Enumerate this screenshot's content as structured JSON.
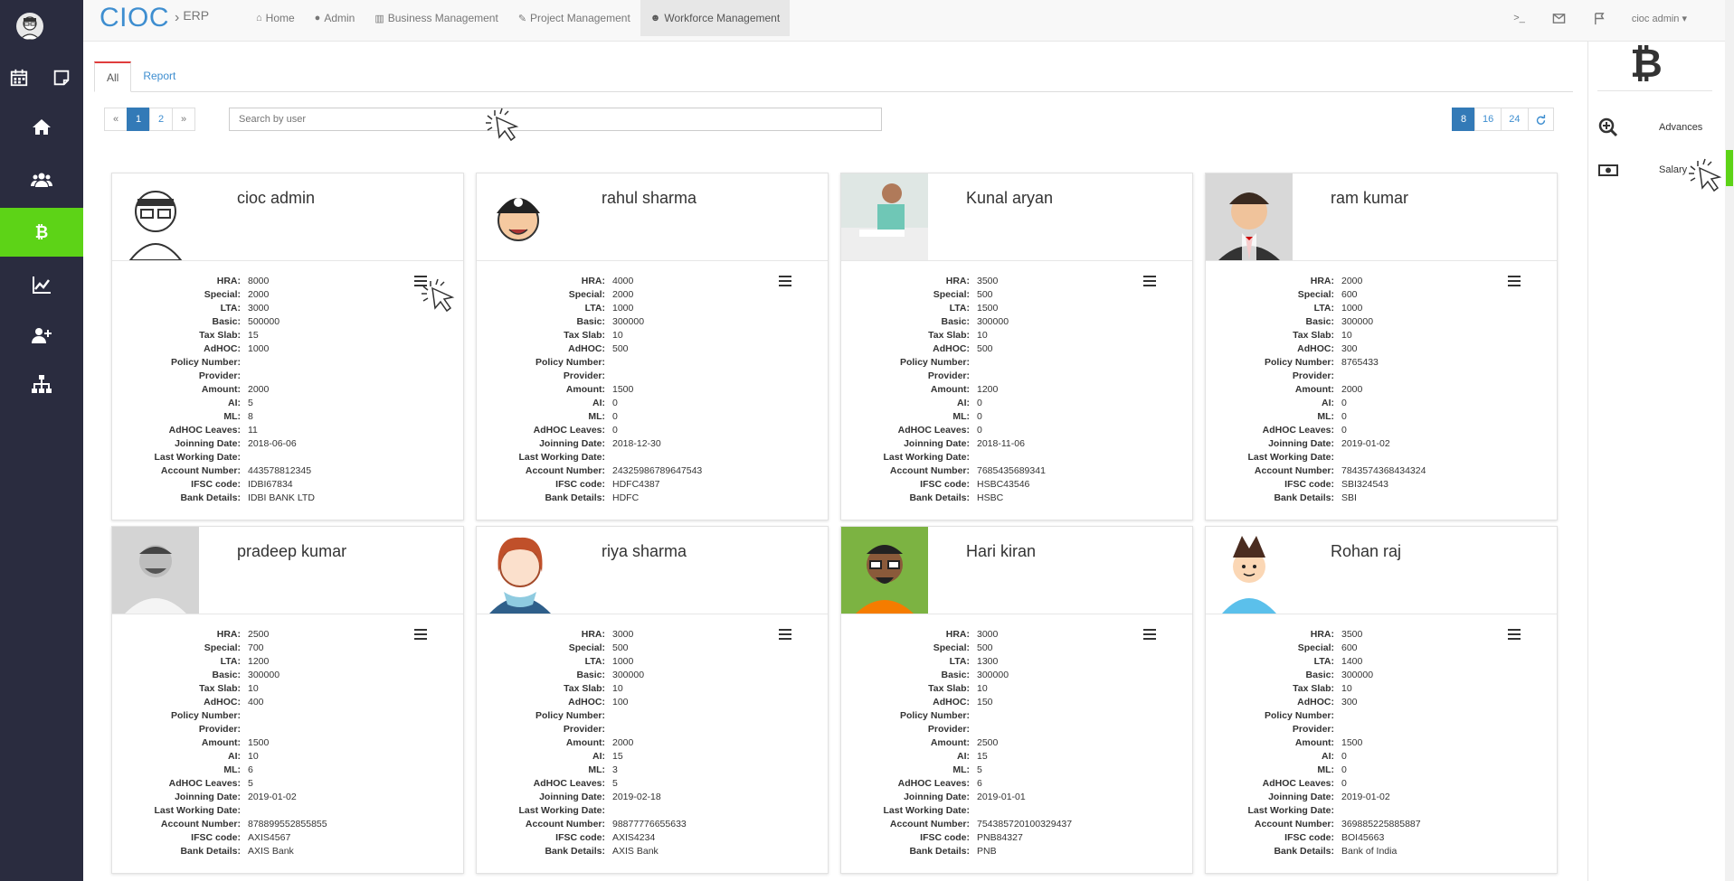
{
  "brand": {
    "logo": "CIOC",
    "separator": "›",
    "subtitle": "ERP"
  },
  "nav": [
    {
      "icon": "⌂",
      "label": "Home"
    },
    {
      "icon": "●",
      "label": "Admin"
    },
    {
      "icon": "▥",
      "label": "Business Management"
    },
    {
      "icon": "✎",
      "label": "Project Management"
    },
    {
      "icon": "☻",
      "label": "Workforce Management"
    }
  ],
  "topright": {
    "terminal": ">_",
    "user": "cioc admin ▾"
  },
  "tabs": {
    "all": "All",
    "report": "Report"
  },
  "pager": {
    "prev": "«",
    "p1": "1",
    "p2": "2",
    "next": "»"
  },
  "search": {
    "placeholder": "Search by user"
  },
  "per_page": {
    "o1": "8",
    "o2": "16",
    "o3": "24"
  },
  "labels": {
    "hra": "HRA:",
    "special": "Special:",
    "lta": "LTA:",
    "basic": "Basic:",
    "tax": "Tax Slab:",
    "adhoc": "AdHOC:",
    "policy": "Policy Number:",
    "provider": "Provider:",
    "amount": "Amount:",
    "al": "AI:",
    "ml": "ML:",
    "adhoc_leaves": "AdHOC Leaves:",
    "joining": "Joinning Date:",
    "last": "Last Working Date:",
    "account": "Account Number:",
    "ifsc": "IFSC code:",
    "bank": "Bank Details:"
  },
  "employees": [
    {
      "name": "cioc admin",
      "hra": "8000",
      "special": "2000",
      "lta": "3000",
      "basic": "500000",
      "tax": "15",
      "adhoc": "1000",
      "policy": "",
      "provider": "",
      "amount": "2000",
      "al": "5",
      "ml": "8",
      "adhoc_leaves": "11",
      "joining": "2018-06-06",
      "last": "",
      "account": "443578812345",
      "ifsc": "IDBI67834",
      "bank": "IDBI BANK LTD"
    },
    {
      "name": "rahul sharma",
      "hra": "4000",
      "special": "2000",
      "lta": "1000",
      "basic": "300000",
      "tax": "10",
      "adhoc": "500",
      "policy": "",
      "provider": "",
      "amount": "1500",
      "al": "0",
      "ml": "0",
      "adhoc_leaves": "0",
      "joining": "2018-12-30",
      "last": "",
      "account": "24325986789647543",
      "ifsc": "HDFC4387",
      "bank": "HDFC"
    },
    {
      "name": "Kunal aryan",
      "hra": "3500",
      "special": "500",
      "lta": "1500",
      "basic": "300000",
      "tax": "10",
      "adhoc": "500",
      "policy": "",
      "provider": "",
      "amount": "1200",
      "al": "0",
      "ml": "0",
      "adhoc_leaves": "0",
      "joining": "2018-11-06",
      "last": "",
      "account": "7685435689341",
      "ifsc": "HSBC43546",
      "bank": "HSBC"
    },
    {
      "name": "ram kumar",
      "hra": "2000",
      "special": "600",
      "lta": "1000",
      "basic": "300000",
      "tax": "10",
      "adhoc": "300",
      "policy": "8765433",
      "provider": "",
      "amount": "2000",
      "al": "0",
      "ml": "0",
      "adhoc_leaves": "0",
      "joining": "2019-01-02",
      "last": "",
      "account": "7843574368434324",
      "ifsc": "SBI324543",
      "bank": "SBI"
    },
    {
      "name": "pradeep kumar",
      "hra": "2500",
      "special": "700",
      "lta": "1200",
      "basic": "300000",
      "tax": "10",
      "adhoc": "400",
      "policy": "",
      "provider": "",
      "amount": "1500",
      "al": "10",
      "ml": "6",
      "adhoc_leaves": "5",
      "joining": "2019-01-02",
      "last": "",
      "account": "878899552855855",
      "ifsc": "AXIS4567",
      "bank": "AXIS Bank"
    },
    {
      "name": "riya sharma",
      "hra": "3000",
      "special": "500",
      "lta": "1000",
      "basic": "300000",
      "tax": "10",
      "adhoc": "100",
      "policy": "",
      "provider": "",
      "amount": "2000",
      "al": "15",
      "ml": "3",
      "adhoc_leaves": "5",
      "joining": "2019-02-18",
      "last": "",
      "account": "98877776655633",
      "ifsc": "AXIS4234",
      "bank": "AXIS Bank"
    },
    {
      "name": "Hari kiran",
      "hra": "3000",
      "special": "500",
      "lta": "1300",
      "basic": "300000",
      "tax": "10",
      "adhoc": "150",
      "policy": "",
      "provider": "",
      "amount": "2500",
      "al": "15",
      "ml": "5",
      "adhoc_leaves": "6",
      "joining": "2019-01-01",
      "last": "",
      "account": "754385720100329437",
      "ifsc": "PNB84327",
      "bank": "PNB"
    },
    {
      "name": "Rohan raj",
      "hra": "3500",
      "special": "600",
      "lta": "1400",
      "basic": "300000",
      "tax": "10",
      "adhoc": "300",
      "policy": "",
      "provider": "",
      "amount": "1500",
      "al": "0",
      "ml": "0",
      "adhoc_leaves": "0",
      "joining": "2019-01-02",
      "last": "",
      "account": "369885225885887",
      "ifsc": "BOI45663",
      "bank": "Bank of India"
    }
  ],
  "rightpanel": {
    "symbol": "₿",
    "advances": "Advances",
    "salary": "Salary"
  },
  "colors": {
    "sidebar": "#2a2c3f",
    "accent_green": "#5dd317",
    "link_blue": "#3e8ed0",
    "primary": "#337ab7"
  }
}
